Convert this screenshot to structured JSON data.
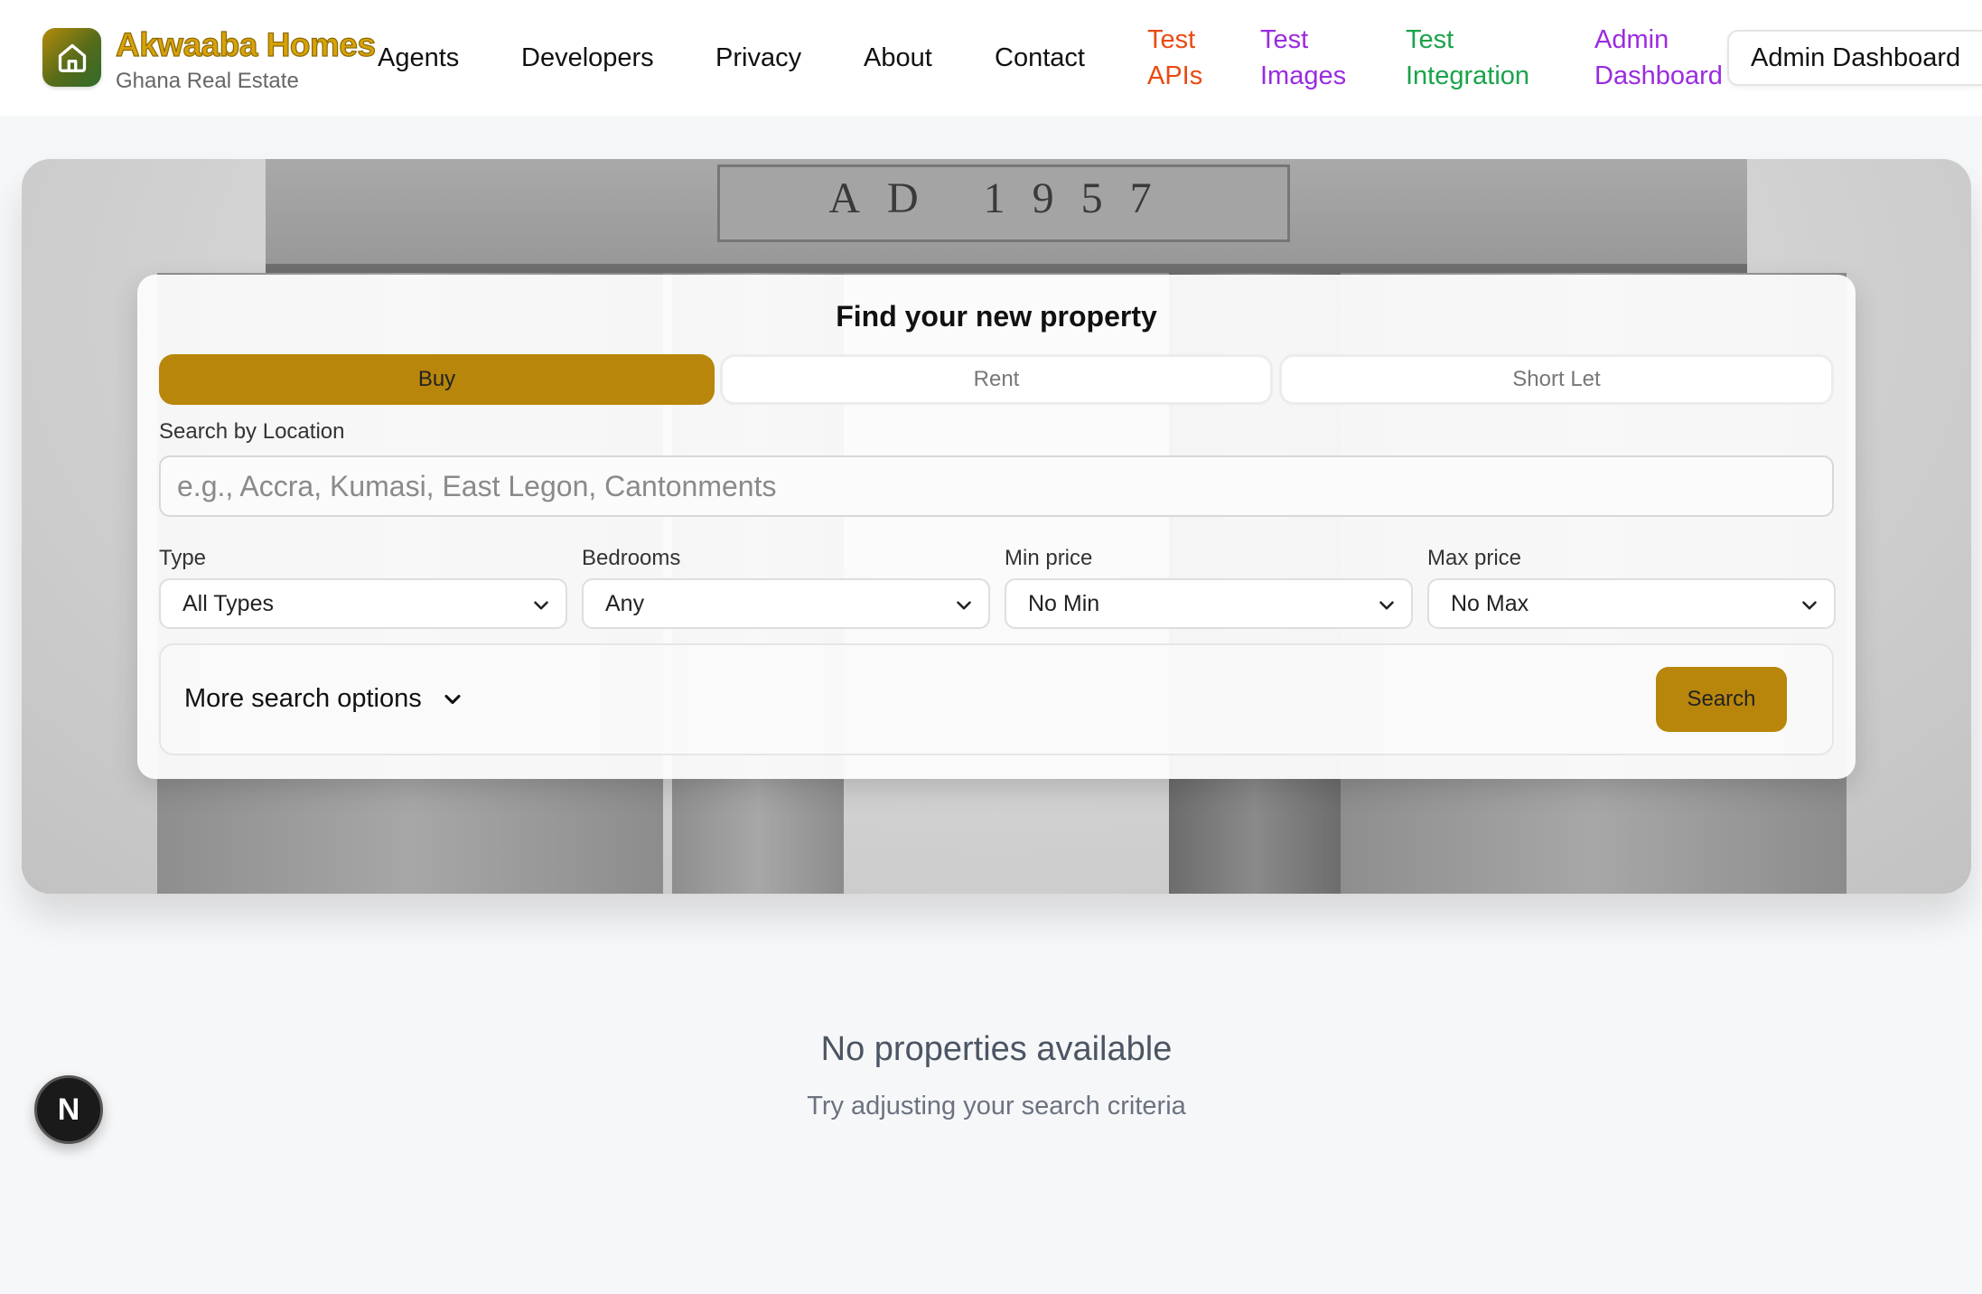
{
  "brand": {
    "name": "Akwaaba Homes",
    "tagline": "Ghana Real Estate",
    "logo_icon": "home-icon"
  },
  "nav": {
    "items": [
      {
        "label": "Agents"
      },
      {
        "label": "Developers"
      },
      {
        "label": "Privacy"
      },
      {
        "label": "About"
      },
      {
        "label": "Contact"
      }
    ],
    "test_apis": {
      "line1": "Test",
      "line2": "APIs",
      "color": "#ea4a12"
    },
    "test_images": {
      "line1": "Test",
      "line2": "Images",
      "color": "#9a2be0"
    },
    "test_integration": {
      "line1": "Test",
      "line2": "Integration",
      "color": "#1aa34a"
    },
    "admin_dashboard": {
      "line1": "Admin",
      "line2": "Dashboard",
      "color": "#9a2be0"
    },
    "admin_button_label": "Admin Dashboard"
  },
  "hero": {
    "inscription": "AD 1957"
  },
  "search": {
    "title": "Find your new property",
    "tabs": [
      {
        "label": "Buy",
        "active": true
      },
      {
        "label": "Rent",
        "active": false
      },
      {
        "label": "Short Let",
        "active": false
      }
    ],
    "location_label": "Search by Location",
    "location_placeholder": "e.g., Accra, Kumasi, East Legon, Cantonments",
    "location_value": "",
    "filters": [
      {
        "label": "Type",
        "value": "All Types"
      },
      {
        "label": "Bedrooms",
        "value": "Any"
      },
      {
        "label": "Min price",
        "value": "No Min"
      },
      {
        "label": "Max price",
        "value": "No Max"
      }
    ],
    "more_options_label": "More search options",
    "search_button_label": "Search",
    "accent_color": "#b8860b"
  },
  "results": {
    "empty_title": "No properties available",
    "empty_subtitle": "Try adjusting your search criteria"
  },
  "dev_badge": {
    "label": "N",
    "icon": "nextjs-icon"
  }
}
